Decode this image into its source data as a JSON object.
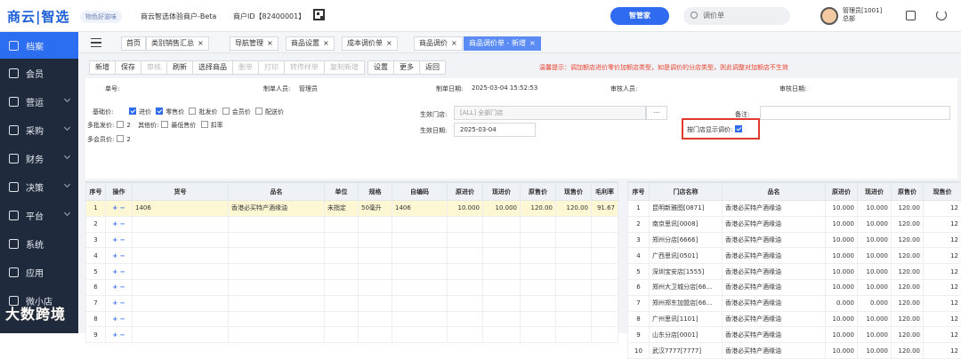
{
  "brand": {
    "name_a": "商云",
    "name_b": "智选",
    "tag": "物色好滋味"
  },
  "header": {
    "merchant": "商云智选体验商户-Beta",
    "merchant_id": "商户ID【82400001】",
    "steward": "智管家",
    "search_placeholder": "调价单",
    "user_line1": "管理员[1001]",
    "user_line2": "总部"
  },
  "sidebar": [
    {
      "label": "档案",
      "active": true
    },
    {
      "label": "会员"
    },
    {
      "label": "营运"
    },
    {
      "label": "采购"
    },
    {
      "label": "财务"
    },
    {
      "label": "决策"
    },
    {
      "label": "平台"
    },
    {
      "label": "系统"
    },
    {
      "label": "应用"
    },
    {
      "label": "微小店"
    }
  ],
  "tabs": [
    "首页",
    "类别销售汇总",
    "导航管理",
    "商品设置",
    "成本调价单",
    "商品调价",
    "商品调价单 - 新增"
  ],
  "toolbar": [
    "新增",
    "保存",
    "审核",
    "刷新",
    "选择商品",
    "删单",
    "打印",
    "转传样单",
    "复制新增",
    "设置",
    "更多",
    "返回"
  ],
  "hint": "温馨提示：调加额店进价零价加额店类型，如是调价的分店类型，则此调整对加额店不生效",
  "form": {
    "doc_no_label": "单号:",
    "maker_label": "制单人员:",
    "maker": "管理员",
    "date_label": "制单日期:",
    "date": "2025-03-04 15:52:53",
    "auditor_label": "审核人员:",
    "audit_date_label": "审核日期:",
    "price_label": "基础价:",
    "p1": "进价",
    "p2": "零售价",
    "p3": "批发价",
    "p4": "会员价",
    "p5": "配送价",
    "multi_wholesale_label": "多批发价:",
    "multi_wholesale_val": "2",
    "other_label": "其他价:",
    "o1": "最低售价",
    "o2": "扣率",
    "multi_member_label": "多会员价:",
    "multi_member_val": "2",
    "store_label": "生效门店:",
    "store_val": "[ALL]    全部门店",
    "eff_date_label": "生效日期:",
    "eff_date": "2025-03-04",
    "remark_label": "备注:",
    "show_by_store": "按门店显示调价:"
  },
  "left_table": {
    "headers": [
      "序号",
      "操作",
      "货号",
      "品名",
      "单位",
      "规格",
      "自编码",
      "原进价",
      "现进价",
      "原售价",
      "现售价",
      "毛利率"
    ],
    "rows": [
      [
        "1",
        "+ −",
        "1406",
        "香港必买特产酒缘油",
        "未指定",
        "50毫升",
        "1406",
        "10.000",
        "10.000",
        "120.00",
        "120.00",
        "91.67"
      ],
      [
        "2",
        "+ −",
        "",
        "",
        "",
        "",
        "",
        "",
        "",
        "",
        "",
        ""
      ],
      [
        "3",
        "+ −",
        "",
        "",
        "",
        "",
        "",
        "",
        "",
        "",
        "",
        ""
      ],
      [
        "4",
        "+ −",
        "",
        "",
        "",
        "",
        "",
        "",
        "",
        "",
        "",
        ""
      ],
      [
        "5",
        "+ −",
        "",
        "",
        "",
        "",
        "",
        "",
        "",
        "",
        "",
        ""
      ],
      [
        "6",
        "+ −",
        "",
        "",
        "",
        "",
        "",
        "",
        "",
        "",
        "",
        ""
      ],
      [
        "7",
        "+ −",
        "",
        "",
        "",
        "",
        "",
        "",
        "",
        "",
        "",
        ""
      ],
      [
        "8",
        "+ −",
        "",
        "",
        "",
        "",
        "",
        "",
        "",
        "",
        "",
        ""
      ],
      [
        "9",
        "+ −",
        "",
        "",
        "",
        "",
        "",
        "",
        "",
        "",
        "",
        ""
      ]
    ]
  },
  "right_table": {
    "headers": [
      "序号",
      "门店名称",
      "品名",
      "原进价",
      "现进价",
      "原售价",
      "现售价"
    ],
    "rows": [
      [
        "1",
        "昆明新雅图[0871]",
        "香港必买特产酒缘油",
        "10.000",
        "10.000",
        "120.00",
        "12"
      ],
      [
        "2",
        "南京思讯[0008]",
        "香港必买特产酒缘油",
        "10.000",
        "10.000",
        "120.00",
        "12"
      ],
      [
        "3",
        "郑州分店[6666]",
        "香港必买特产酒缘油",
        "10.000",
        "10.000",
        "120.00",
        "12"
      ],
      [
        "4",
        "广西思讯[0501]",
        "香港必买特产酒缘油",
        "10.000",
        "10.000",
        "120.00",
        "12"
      ],
      [
        "5",
        "深圳宝安店[1555]",
        "香港必买特产酒缘油",
        "10.000",
        "10.000",
        "120.00",
        "12"
      ],
      [
        "6",
        "郑州大卫城分店[66...",
        "香港必买特产酒缘油",
        "10.000",
        "10.000",
        "120.00",
        "12"
      ],
      [
        "7",
        "郑州郑东加盟店[66...",
        "香港必买特产酒缘油",
        "0.000",
        "0.000",
        "120.00",
        "12"
      ],
      [
        "8",
        "广州思讯[1101]",
        "香港必买特产酒缘油",
        "10.000",
        "10.000",
        "120.00",
        "12"
      ],
      [
        "9",
        "山东分店[0001]",
        "香港必买特产酒缘油",
        "10.000",
        "10.000",
        "120.00",
        "12"
      ],
      [
        "10",
        "武汉7777[7777]",
        "香港必买特产酒缘油",
        "10.000",
        "10.000",
        "120.00",
        "12"
      ]
    ]
  },
  "watermark": "大数跨境"
}
